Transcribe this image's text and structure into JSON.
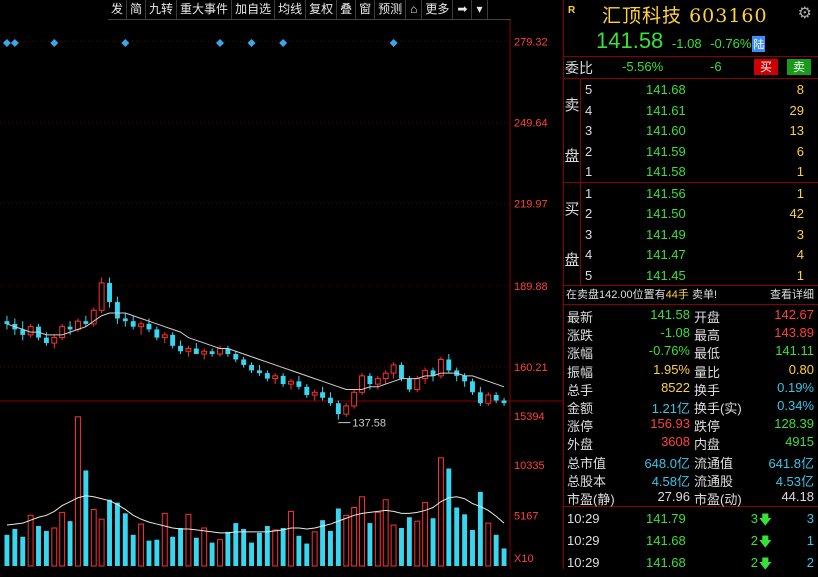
{
  "toolbar": [
    "发",
    "简",
    "九转",
    "重大事件",
    "加自选",
    "均线",
    "复权",
    "叠",
    "窗",
    "预测",
    "⌂",
    "更多",
    "➡",
    "▾"
  ],
  "stock": {
    "badge": "R",
    "name": "汇顶科技",
    "code": "603160",
    "price": "141.58",
    "change": "-1.08",
    "change_pct": "-0.76%",
    "market": "陆"
  },
  "webi": {
    "label": "委比",
    "pct": "-5.56%",
    "diff": "-6",
    "buy": "买",
    "sell": "卖"
  },
  "sell_label": [
    "卖",
    "盘"
  ],
  "buy_label": [
    "买",
    "盘"
  ],
  "asks": [
    {
      "level": "5",
      "price": "141.68",
      "vol": "8"
    },
    {
      "level": "4",
      "price": "141.61",
      "vol": "29"
    },
    {
      "level": "3",
      "price": "141.60",
      "vol": "13"
    },
    {
      "level": "2",
      "price": "141.59",
      "vol": "6"
    },
    {
      "level": "1",
      "price": "141.58",
      "vol": "1"
    }
  ],
  "bids": [
    {
      "level": "1",
      "price": "141.56",
      "vol": "1"
    },
    {
      "level": "2",
      "price": "141.50",
      "vol": "42"
    },
    {
      "level": "3",
      "price": "141.49",
      "vol": "3"
    },
    {
      "level": "4",
      "price": "141.47",
      "vol": "4"
    },
    {
      "level": "5",
      "price": "141.45",
      "vol": "1"
    }
  ],
  "note": {
    "prefix": "在卖盘142.00位置有",
    "vol": "44手",
    "suffix": "卖单!",
    "detail": "查看详细"
  },
  "quote": [
    {
      "k1": "最新",
      "v1": "141.58",
      "c1": "green",
      "k2": "开盘",
      "v2": "142.67",
      "c2": "red"
    },
    {
      "k1": "涨跌",
      "v1": "-1.08",
      "c1": "green",
      "k2": "最高",
      "v2": "143.89",
      "c2": "red"
    },
    {
      "k1": "涨幅",
      "v1": "-0.76%",
      "c1": "green",
      "k2": "最低",
      "v2": "141.11",
      "c2": "green"
    },
    {
      "k1": "振幅",
      "v1": "1.95%",
      "c1": "yellow",
      "k2": "量比",
      "v2": "0.80",
      "c2": "yellow"
    },
    {
      "k1": "总手",
      "v1": "8522",
      "c1": "yellow",
      "k2": "换手",
      "v2": "0.19%",
      "c2": "cyan"
    },
    {
      "k1": "金额",
      "v1": "1.21亿",
      "c1": "cyan",
      "k2": "换手(实)",
      "v2": "0.34%",
      "c2": "cyan"
    },
    {
      "k1": "涨停",
      "v1": "156.93",
      "c1": "red",
      "k2": "跌停",
      "v2": "128.39",
      "c2": "green"
    },
    {
      "k1": "外盘",
      "v1": "3608",
      "c1": "red",
      "k2": "内盘",
      "v2": "4915",
      "c2": "green"
    },
    {
      "k1": "总市值",
      "v1": "648.0亿",
      "c1": "cyan",
      "k2": "流通值",
      "v2": "641.8亿",
      "c2": "cyan"
    },
    {
      "k1": "总股本",
      "v1": "4.58亿",
      "c1": "cyan",
      "k2": "流通股",
      "v2": "4.53亿",
      "c2": "cyan"
    },
    {
      "k1": "市盈(静)",
      "v1": "27.96",
      "c1": "white",
      "k2": "市盈(动)",
      "v2": "44.18",
      "c2": "white"
    }
  ],
  "ticks": [
    {
      "time": "10:29",
      "price": "141.79",
      "vol": "3",
      "cnt": "3"
    },
    {
      "time": "10:29",
      "price": "141.68",
      "vol": "2",
      "cnt": "1"
    },
    {
      "time": "10:29",
      "price": "141.68",
      "vol": "2",
      "cnt": "2"
    }
  ],
  "chart_data": {
    "type": "candlestick",
    "price_axis_labels": [
      "279.32",
      "249.64",
      "219.97",
      "189.88",
      "160.21"
    ],
    "price_range": [
      150,
      285
    ],
    "low_marker": "137.58",
    "candles": [
      [
        177,
        179,
        174,
        176
      ],
      [
        176,
        178,
        172,
        174
      ],
      [
        174,
        177,
        170,
        172
      ],
      [
        172,
        176,
        171,
        175
      ],
      [
        175,
        176,
        170,
        171
      ],
      [
        171,
        173,
        168,
        169
      ],
      [
        169,
        172,
        167,
        171
      ],
      [
        171,
        176,
        170,
        175
      ],
      [
        175,
        177,
        172,
        174
      ],
      [
        174,
        178,
        173,
        177
      ],
      [
        177,
        179,
        175,
        176
      ],
      [
        176,
        182,
        175,
        181
      ],
      [
        181,
        193,
        180,
        191
      ],
      [
        191,
        193,
        182,
        184
      ],
      [
        184,
        186,
        176,
        178
      ],
      [
        178,
        180,
        175,
        177
      ],
      [
        177,
        179,
        174,
        175
      ],
      [
        175,
        177,
        172,
        176
      ],
      [
        176,
        178,
        173,
        174
      ],
      [
        174,
        175,
        170,
        171
      ],
      [
        171,
        173,
        169,
        172
      ],
      [
        172,
        173,
        167,
        168
      ],
      [
        168,
        170,
        165,
        166
      ],
      [
        166,
        168,
        164,
        167
      ],
      [
        167,
        169,
        165,
        165
      ],
      [
        165,
        167,
        163,
        166
      ],
      [
        166,
        167,
        164,
        165
      ],
      [
        165,
        168,
        164,
        167
      ],
      [
        167,
        168,
        164,
        165
      ],
      [
        165,
        166,
        162,
        163
      ],
      [
        163,
        164,
        160,
        161
      ],
      [
        161,
        162,
        158,
        159
      ],
      [
        159,
        161,
        157,
        158
      ],
      [
        158,
        159,
        155,
        156
      ],
      [
        156,
        158,
        154,
        157
      ],
      [
        157,
        158,
        153,
        154
      ],
      [
        154,
        156,
        152,
        155
      ],
      [
        155,
        157,
        152,
        153
      ],
      [
        153,
        154,
        149,
        150
      ],
      [
        150,
        152,
        148,
        151
      ],
      [
        151,
        153,
        148,
        149
      ],
      [
        149,
        151,
        146,
        147
      ],
      [
        147,
        148,
        141,
        143
      ],
      [
        143,
        147,
        142,
        146
      ],
      [
        146,
        152,
        145,
        151
      ],
      [
        151,
        158,
        150,
        157
      ],
      [
        157,
        158,
        152,
        154
      ],
      [
        154,
        157,
        152,
        156
      ],
      [
        156,
        159,
        154,
        158
      ],
      [
        158,
        162,
        156,
        161
      ],
      [
        161,
        162,
        155,
        156
      ],
      [
        156,
        157,
        151,
        152
      ],
      [
        152,
        157,
        151,
        156
      ],
      [
        156,
        160,
        154,
        159
      ],
      [
        159,
        160,
        155,
        157
      ],
      [
        157,
        164,
        156,
        163
      ],
      [
        163,
        165,
        158,
        159
      ],
      [
        159,
        160,
        155,
        157
      ],
      [
        157,
        158,
        153,
        155
      ],
      [
        155,
        156,
        150,
        151
      ],
      [
        151,
        153,
        146,
        147
      ],
      [
        147,
        151,
        146,
        150
      ],
      [
        150,
        151,
        147,
        148
      ],
      [
        148,
        149,
        146,
        147
      ]
    ],
    "ma_line": [
      176,
      175,
      174,
      173,
      173,
      172,
      172,
      172,
      173,
      174,
      175,
      177,
      179,
      180,
      180,
      180,
      179,
      178,
      177,
      176,
      175,
      174,
      173,
      171,
      170,
      169,
      168,
      167,
      167,
      166,
      165,
      164,
      163,
      162,
      161,
      160,
      159,
      158,
      157,
      156,
      155,
      154,
      153,
      152,
      152,
      152,
      153,
      153,
      154,
      155,
      156,
      156,
      156,
      157,
      157,
      158,
      158,
      158,
      157,
      157,
      156,
      155,
      154,
      153
    ],
    "signal_markers": [
      0,
      1,
      6,
      15,
      27,
      31,
      35,
      49
    ],
    "volume_axis_labels": [
      "15394",
      "10335",
      "5167",
      "X10"
    ],
    "volume_range": [
      0,
      16000
    ],
    "volumes": [
      3200,
      3800,
      3000,
      5200,
      4100,
      3600,
      3900,
      5500,
      4600,
      15300,
      9800,
      5800,
      4800,
      6800,
      6500,
      5400,
      3200,
      4300,
      2600,
      2700,
      5400,
      3000,
      3900,
      5300,
      2900,
      3900,
      2400,
      2700,
      3500,
      4400,
      3800,
      2400,
      3400,
      4100,
      3700,
      3900,
      5600,
      3100,
      2300,
      3500,
      4700,
      3600,
      5900,
      5200,
      6000,
      7100,
      4400,
      5500,
      6800,
      4200,
      3900,
      5000,
      4600,
      6500,
      4900,
      11100,
      10000,
      6000,
      5300,
      3700,
      7600,
      4400,
      3200,
      1800
    ],
    "volume_ma": [
      4200,
      4300,
      4400,
      4700,
      5000,
      5200,
      5600,
      6200,
      6600,
      7000,
      7200,
      7100,
      6900,
      6700,
      6300,
      5800,
      5200,
      4800,
      4500,
      4300,
      4100,
      3900,
      3800,
      3800,
      3700,
      3600,
      3500,
      3400,
      3400,
      3500,
      3500,
      3500,
      3500,
      3500,
      3600,
      3700,
      3900,
      3900,
      3800,
      3900,
      4100,
      4300,
      4600,
      4900,
      5200,
      5400,
      5500,
      5600,
      5700,
      5600,
      5400,
      5400,
      5500,
      5700,
      6000,
      6600,
      7000,
      7100,
      6900,
      6400,
      6100,
      5700,
      5100,
      4400
    ]
  }
}
